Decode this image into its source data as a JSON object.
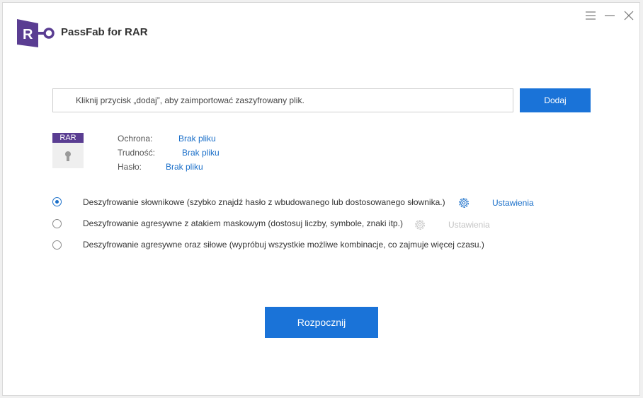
{
  "app": {
    "title": "PassFab for RAR",
    "logo_letter": "R"
  },
  "window_controls": {
    "menu_icon": "hamburger-icon",
    "minimize_icon": "minimize-icon",
    "close_icon": "close-icon"
  },
  "file": {
    "placeholder": "Kliknij przycisk „dodaj”, aby zaimportować zaszyfrowany plik.",
    "add_label": "Dodaj",
    "icon_badge": "RAR"
  },
  "info": {
    "protection_label": "Ochrona:",
    "protection_value": "Brak pliku",
    "difficulty_label": "Trudność:",
    "difficulty_value": "Brak pliku",
    "password_label": "Hasło:",
    "password_value": "Brak pliku"
  },
  "options": [
    {
      "label": "Deszyfrowanie słownikowe (szybko znajdź hasło z wbudowanego lub dostosowanego słownika.)",
      "selected": true,
      "settings": "Ustawienia",
      "settings_enabled": true
    },
    {
      "label": "Deszyfrowanie agresywne z atakiem maskowym (dostosuj liczby, symbole, znaki itp.)",
      "selected": false,
      "settings": "Ustawienia",
      "settings_enabled": false
    },
    {
      "label": "Deszyfrowanie agresywne oraz siłowe (wypróbuj wszystkie możliwe kombinacje, co zajmuje więcej czasu.)",
      "selected": false
    }
  ],
  "start_label": "Rozpocznij",
  "colors": {
    "accent": "#1a73d8",
    "brand": "#5a3d92",
    "link": "#1a6fc9"
  }
}
